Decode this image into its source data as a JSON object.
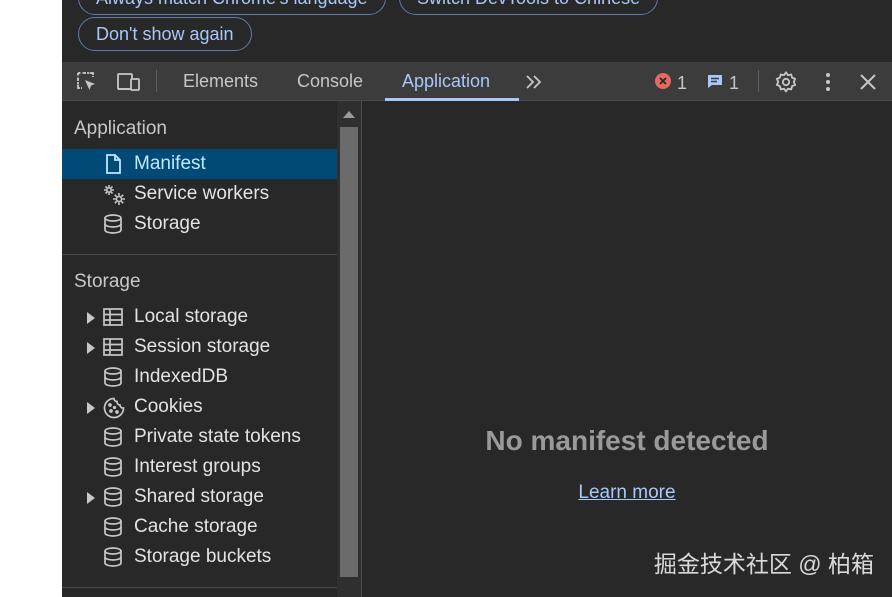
{
  "notification": {
    "buttons": [
      {
        "label": "Always match Chrome's language"
      },
      {
        "label": "Switch DevTools to Chinese"
      },
      {
        "label": "Don't show again"
      }
    ]
  },
  "tabbar": {
    "tabs": [
      {
        "label": "Elements"
      },
      {
        "label": "Console"
      },
      {
        "label": "Application"
      }
    ],
    "active_tab": "Application",
    "error_count": "1",
    "message_count": "1"
  },
  "sidebar": {
    "application_title": "Application",
    "application_items": [
      {
        "label": "Manifest",
        "icon": "document-icon",
        "selected": true
      },
      {
        "label": "Service workers",
        "icon": "gears-icon"
      },
      {
        "label": "Storage",
        "icon": "database-icon"
      }
    ],
    "storage_title": "Storage",
    "storage_items": [
      {
        "label": "Local storage",
        "icon": "table-icon",
        "expandable": true
      },
      {
        "label": "Session storage",
        "icon": "table-icon",
        "expandable": true
      },
      {
        "label": "IndexedDB",
        "icon": "database-icon"
      },
      {
        "label": "Cookies",
        "icon": "cookie-icon",
        "expandable": true
      },
      {
        "label": "Private state tokens",
        "icon": "database-icon"
      },
      {
        "label": "Interest groups",
        "icon": "database-icon"
      },
      {
        "label": "Shared storage",
        "icon": "database-icon",
        "expandable": true
      },
      {
        "label": "Cache storage",
        "icon": "database-icon"
      },
      {
        "label": "Storage buckets",
        "icon": "database-icon"
      }
    ]
  },
  "main": {
    "empty_title": "No manifest detected",
    "learn_more": "Learn more"
  },
  "watermark": "掘金技术社区 @ 柏箱",
  "colors": {
    "accent": "#a8c7fa",
    "selected_bg": "#004a77",
    "error": "#e46962",
    "panel_bg": "#282828"
  }
}
